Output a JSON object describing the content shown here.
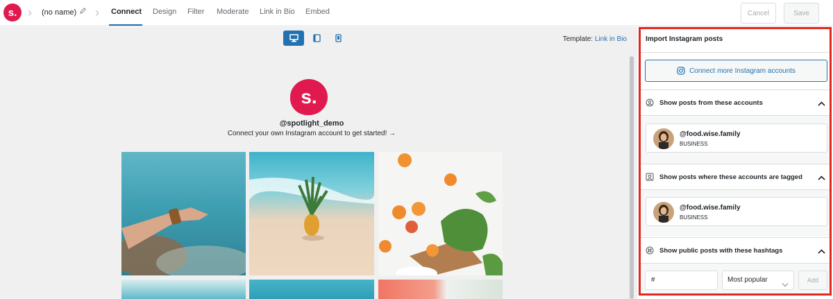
{
  "app": {
    "logo_text": "s.",
    "feed_name": "(no name)",
    "brand_color": "#e01a4f",
    "accent_color": "#2271b1"
  },
  "tabs": [
    {
      "label": "Connect",
      "active": true
    },
    {
      "label": "Design",
      "active": false
    },
    {
      "label": "Filter",
      "active": false
    },
    {
      "label": "Moderate",
      "active": false
    },
    {
      "label": "Link in Bio",
      "active": false
    },
    {
      "label": "Embed",
      "active": false
    }
  ],
  "toolbar": {
    "cancel_label": "Cancel",
    "save_label": "Save"
  },
  "preview": {
    "device_icons": [
      "desktop-icon",
      "tablet-icon",
      "phone-icon"
    ],
    "active_device": "desktop",
    "template_label": "Template:",
    "template_value": "Link in Bio",
    "profile_logo_text": "s.",
    "handle": "@spotlight_demo",
    "tagline": "Connect your own Instagram account to get started! →"
  },
  "panel": {
    "title": "Import Instagram posts",
    "connect_button": "Connect more Instagram accounts",
    "sections": [
      {
        "label": "Show posts from these accounts",
        "icon": "user-circle-icon",
        "expanded": true
      },
      {
        "label": "Show posts where these accounts are tagged",
        "icon": "tag-person-icon",
        "expanded": true
      },
      {
        "label": "Show public posts with these hashtags",
        "icon": "hashtag-icon",
        "expanded": true
      }
    ],
    "accounts": [
      {
        "name": "@food.wise.family",
        "type": "BUSINESS"
      },
      {
        "name": "@food.wise.family",
        "type": "BUSINESS"
      }
    ],
    "hashtag": {
      "input_value": "#",
      "sort_selected": "Most popular",
      "add_label": "Add"
    },
    "highlight_color": "#e3261d"
  }
}
